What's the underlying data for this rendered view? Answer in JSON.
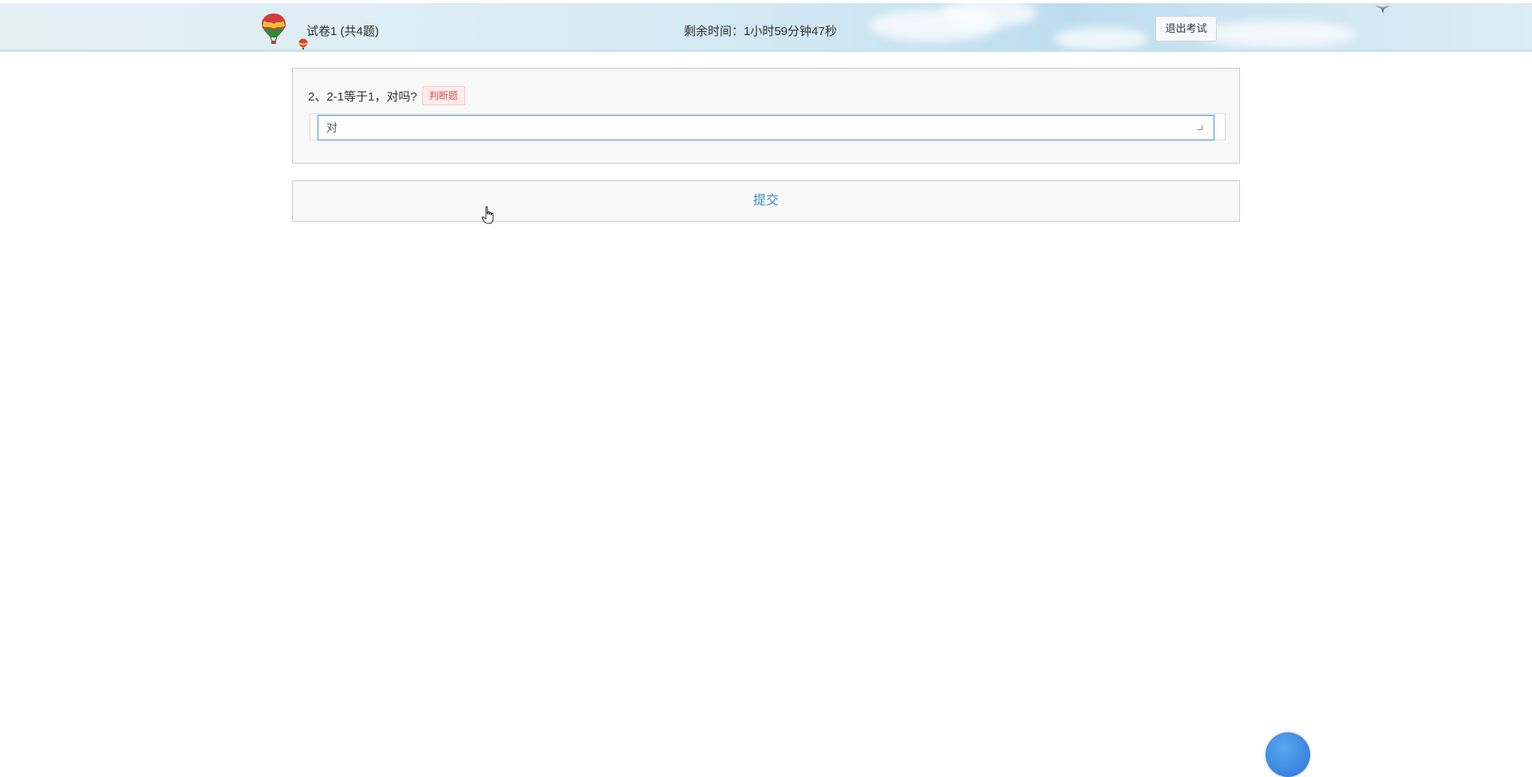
{
  "header": {
    "exam_title": "试卷1 (共4题)",
    "timer_text": "剩余时间：1小时59分钟47秒",
    "exit_label": "退出考试"
  },
  "question": {
    "text": "2、2-1等于1，对吗?",
    "type_tag": "判断题",
    "selected_answer": "对"
  },
  "submit": {
    "label": "提交"
  },
  "colors": {
    "accent": "#3a8fbf",
    "tag": "#d9534f",
    "select_border": "#4a90c9"
  },
  "icons": {
    "logo": "hot-air-balloon-icon",
    "cursor": "hand-pointer-icon",
    "float": "assistant-bubble-icon"
  }
}
